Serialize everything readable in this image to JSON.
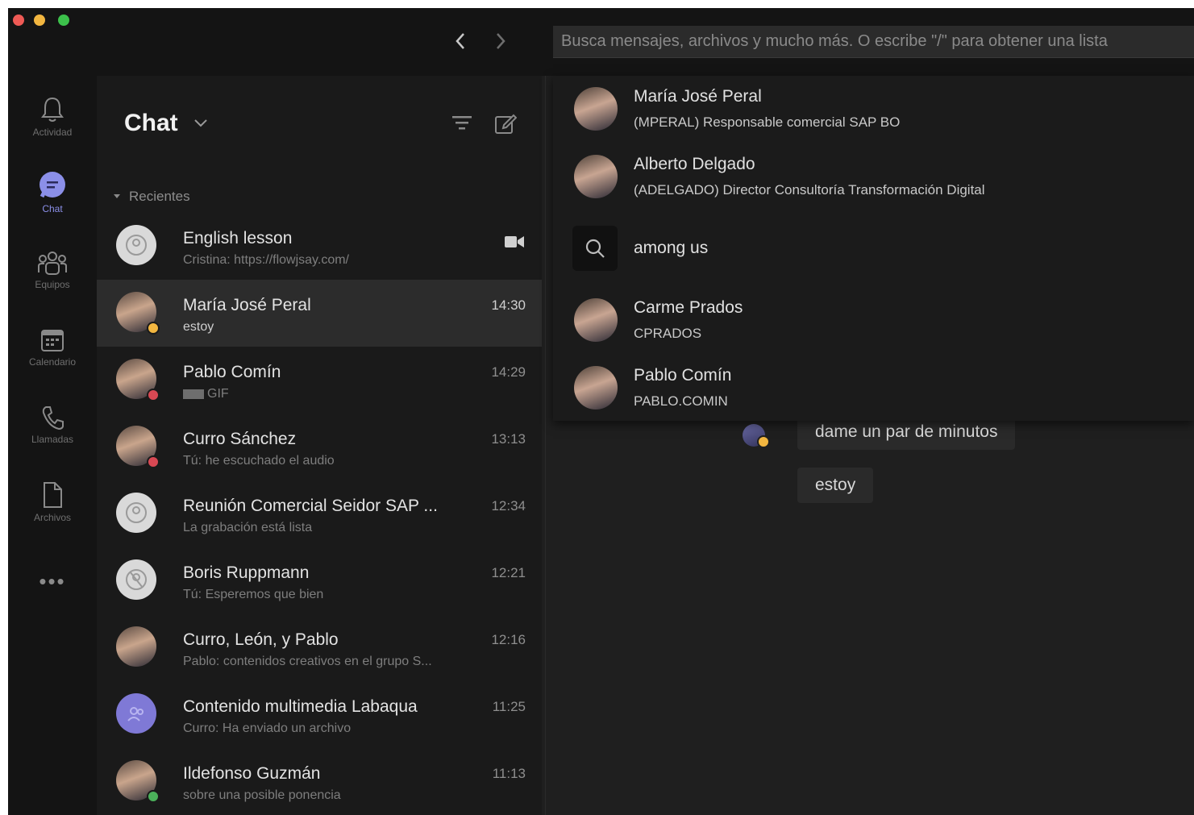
{
  "search": {
    "placeholder": "Busca mensajes, archivos y mucho más. O escribe \"/\" para obtener una lista"
  },
  "rail": {
    "items": [
      {
        "label": "Actividad",
        "icon": "bell-icon"
      },
      {
        "label": "Chat",
        "icon": "chat-icon"
      },
      {
        "label": "Equipos",
        "icon": "teams-icon"
      },
      {
        "label": "Calendario",
        "icon": "calendar-icon"
      },
      {
        "label": "Llamadas",
        "icon": "phone-icon"
      },
      {
        "label": "Archivos",
        "icon": "file-icon"
      }
    ],
    "more": "•••"
  },
  "list": {
    "title": "Chat",
    "section": "Recientes",
    "chats": [
      {
        "name": "English lesson",
        "preview": "Cristina: https://flowjsay.com/",
        "time": "",
        "avatar": "generic"
      },
      {
        "name": "María José Peral",
        "preview": "estoy",
        "time": "14:30",
        "avatar": "person",
        "presence": "away"
      },
      {
        "name": "Pablo Comín",
        "preview": "GIF",
        "time": "14:29",
        "avatar": "person",
        "presence": "busy"
      },
      {
        "name": "Curro Sánchez",
        "preview": "Tú: he escuchado el audio",
        "time": "13:13",
        "avatar": "person",
        "presence": "busy"
      },
      {
        "name": "Reunión Comercial Seidor SAP ...",
        "preview": "La grabación está lista",
        "time": "12:34",
        "avatar": "generic"
      },
      {
        "name": "Boris Ruppmann",
        "preview": "Tú: Esperemos que bien",
        "time": "12:21",
        "avatar": "generic"
      },
      {
        "name": "Curro, León, y Pablo",
        "preview": "Pablo: contenidos creativos en el grupo S...",
        "time": "12:16",
        "avatar": "person"
      },
      {
        "name": "Contenido multimedia Labaqua",
        "preview": "Curro: Ha enviado un archivo",
        "time": "11:25",
        "avatar": "purple"
      },
      {
        "name": "Ildefonso Guzmán",
        "preview": "sobre una posible ponencia",
        "time": "11:13",
        "avatar": "person",
        "presence": "available"
      }
    ]
  },
  "dropdown": {
    "people_top": [
      {
        "name": "María José Peral",
        "sub": "(MPERAL) Responsable comercial SAP BO"
      },
      {
        "name": "Alberto Delgado",
        "sub": "(ADELGADO) Director Consultoría Transformación Digital"
      }
    ],
    "query": "among us",
    "people_bottom": [
      {
        "name": "Carme Prados",
        "sub": "CPRADOS"
      },
      {
        "name": "Pablo Comín",
        "sub": "PABLO.COMIN"
      }
    ]
  },
  "conversation": {
    "messages": [
      "dame un par de minutos",
      "estoy"
    ]
  },
  "colors": {
    "accent": "#7f79d6",
    "background": "#1f1f1f",
    "away": "#f2b640",
    "busy": "#d84853",
    "available": "#4bb05a"
  }
}
